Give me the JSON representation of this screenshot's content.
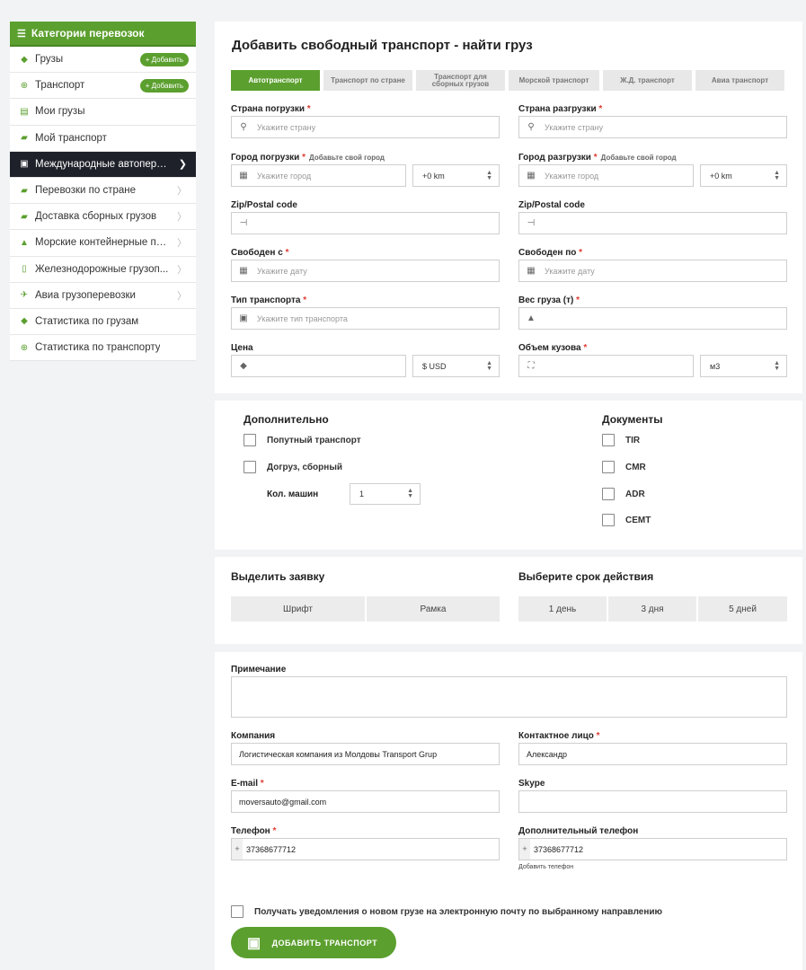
{
  "sidebar": {
    "header": "Категории перевозок",
    "add_label": "+ Добавить",
    "items": [
      {
        "label": "Грузы",
        "icon": "cubes-icon"
      },
      {
        "label": "Транспорт",
        "icon": "globe-icon"
      },
      {
        "label": "Мои грузы",
        "icon": "clipboard-icon"
      },
      {
        "label": "Мой транспорт",
        "icon": "truck-icon"
      },
      {
        "label": "Международные автопере...",
        "icon": "truck-front-icon"
      },
      {
        "label": "Перевозки по стране",
        "icon": "truck-icon"
      },
      {
        "label": "Доставка сборных грузов",
        "icon": "truck-icon"
      },
      {
        "label": "Морские контейнерные пе...",
        "icon": "ship-icon"
      },
      {
        "label": "Железнодорожные грузоп...",
        "icon": "train-icon"
      },
      {
        "label": "Авиа грузоперевозки",
        "icon": "plane-icon"
      },
      {
        "label": "Статистика по грузам",
        "icon": "cubes-icon"
      },
      {
        "label": "Статистика по транспорту",
        "icon": "globe-icon"
      }
    ]
  },
  "form": {
    "title": "Добавить свободный транспорт - найти груз",
    "tabs": [
      "Автотранспорт",
      "Транспорт по стране",
      "Транспорт для сборных грузов",
      "Морской транспорт",
      "Ж.Д. транспорт",
      "Авиа транспорт"
    ],
    "load_country_label": "Страна погрузки",
    "unload_country_label": "Страна разгрузки",
    "country_placeholder": "Укажите страну",
    "load_city_label": "Город погрузки",
    "unload_city_label": "Город разгрузки",
    "add_city_hint": "Добавьте свой город",
    "add_city_hint_right": "Добавьте свой город",
    "city_placeholder": "Укажите город",
    "radius_value": "+0 km",
    "zip_label": "Zip/Postal code",
    "free_from_label": "Свободен с",
    "free_to_label": "Свободен по",
    "date_placeholder": "Укажите дату",
    "transport_type_label": "Тип транспорта",
    "transport_type_placeholder": "Укажите тип транспорта",
    "weight_label": "Вес груза (т)",
    "price_label": "Цена",
    "currency_value": "$ USD",
    "volume_label": "Объем кузова",
    "volume_unit": "м3",
    "req": "*"
  },
  "extra": {
    "title": "Дополнительно",
    "options": [
      "Попутный транспорт",
      "Догруз, сборный"
    ],
    "vehicles_label": "Кол. машин",
    "vehicles_value": "1",
    "docs_title": "Документы",
    "docs": [
      "TIR",
      "CMR",
      "ADR",
      "CEMT"
    ]
  },
  "highlight": {
    "title": "Выделить заявку",
    "options": [
      "Шрифт",
      "Рамка"
    ],
    "term_title": "Выберите срок действия",
    "terms": [
      "1 день",
      "3 дня",
      "5 дней"
    ]
  },
  "contact": {
    "note_label": "Примечание",
    "company_label": "Компания",
    "company_value": "Логистическая компания из Молдовы Transport Grup",
    "contact_label": "Контактное лицо",
    "contact_value": "Александр",
    "email_label": "E-mail",
    "email_value": "moversauto@gmail.com",
    "skype_label": "Skype",
    "phone_label": "Телефон",
    "phone_value": "37368677712",
    "phone2_label": "Дополнительный телефон",
    "phone2_value": "37368677712",
    "add_phone": "Добавить телефон",
    "notify_label": "Получать уведомления о новом грузе на электронную почту по выбранному направлению",
    "submit_label": "ДОБАВИТЬ ТРАНСПОРТ",
    "plus": "+"
  }
}
